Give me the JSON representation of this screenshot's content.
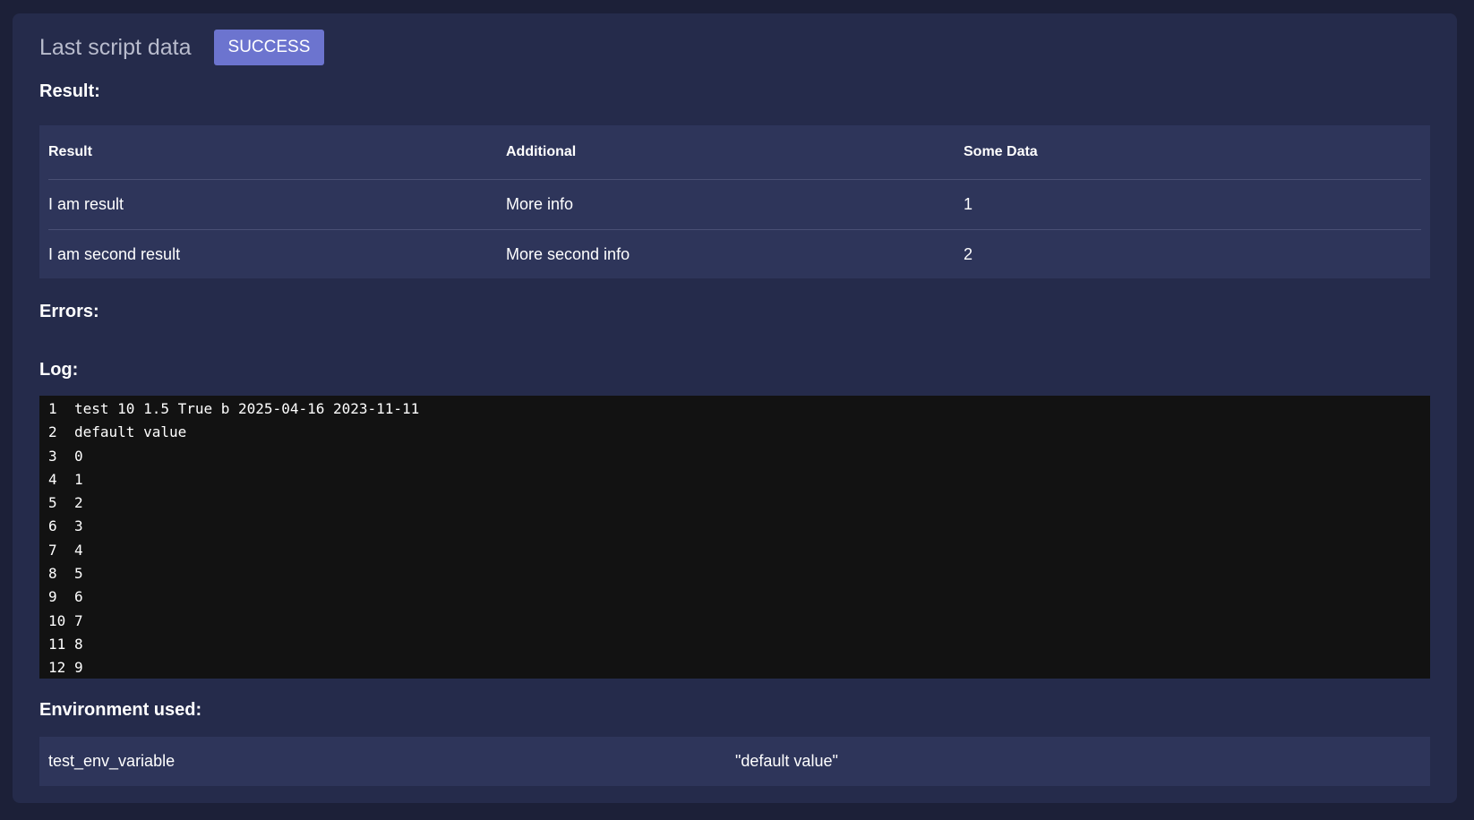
{
  "header": {
    "title": "Last script data",
    "status": "SUCCESS"
  },
  "result": {
    "title": "Result:",
    "columns": [
      "Result",
      "Additional",
      "Some Data"
    ],
    "rows": [
      [
        "I am result",
        "More info",
        "1"
      ],
      [
        "I am second result",
        "More second info",
        "2"
      ]
    ]
  },
  "errors": {
    "title": "Errors:"
  },
  "log": {
    "title": "Log:",
    "lines": [
      {
        "num": "1",
        "text": "test 10 1.5 True b 2025-04-16 2023-11-11"
      },
      {
        "num": "2",
        "text": "default value"
      },
      {
        "num": "3",
        "text": "0"
      },
      {
        "num": "4",
        "text": "1"
      },
      {
        "num": "5",
        "text": "2"
      },
      {
        "num": "6",
        "text": "3"
      },
      {
        "num": "7",
        "text": "4"
      },
      {
        "num": "8",
        "text": "5"
      },
      {
        "num": "9",
        "text": "6"
      },
      {
        "num": "10",
        "text": "7"
      },
      {
        "num": "11",
        "text": "8"
      },
      {
        "num": "12",
        "text": "9"
      }
    ]
  },
  "environment": {
    "title": "Environment used:",
    "rows": [
      {
        "key": "test_env_variable",
        "value": "\"default value\""
      }
    ]
  },
  "colors": {
    "background": "#1c2038",
    "card": "#252b4b",
    "table": "#2e355a",
    "badge": "#6c74cf",
    "log_bg": "#121212"
  }
}
